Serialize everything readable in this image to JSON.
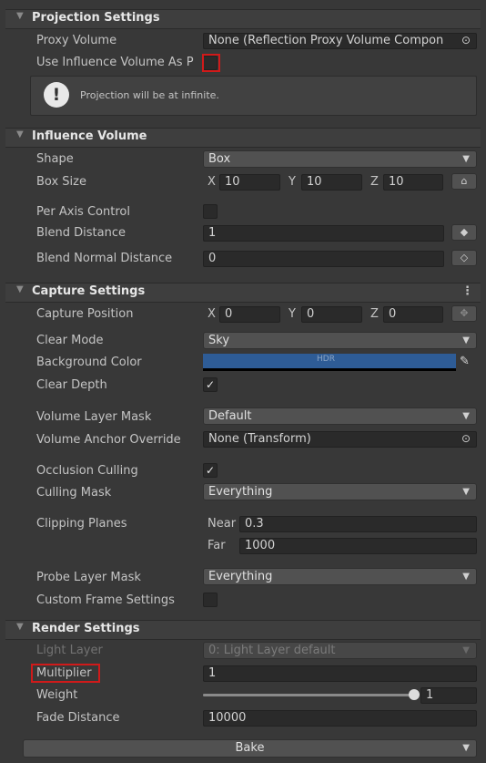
{
  "projection": {
    "title": "Projection Settings",
    "proxy_volume_label": "Proxy Volume",
    "proxy_volume_value": "None (Reflection Proxy Volume Compon",
    "use_influence_label": "Use Influence Volume As P",
    "help_text": "Projection will be at infinite."
  },
  "influence": {
    "title": "Influence Volume",
    "shape_label": "Shape",
    "shape_value": "Box",
    "box_size_label": "Box Size",
    "box_x": "10",
    "box_y": "10",
    "box_z": "10",
    "per_axis_label": "Per Axis Control",
    "blend_distance_label": "Blend Distance",
    "blend_distance_value": "1",
    "blend_normal_label": "Blend Normal Distance",
    "blend_normal_value": "0"
  },
  "capture": {
    "title": "Capture Settings",
    "position_label": "Capture Position",
    "pos_x": "0",
    "pos_y": "0",
    "pos_z": "0",
    "clear_mode_label": "Clear Mode",
    "clear_mode_value": "Sky",
    "bg_color_label": "Background Color",
    "bg_color_badge": "HDR",
    "bg_color_hex": "#2e5c96",
    "clear_depth_label": "Clear Depth",
    "volume_layer_label": "Volume Layer Mask",
    "volume_layer_value": "Default",
    "anchor_label": "Volume Anchor Override",
    "anchor_value": "None (Transform)",
    "occlusion_label": "Occlusion Culling",
    "culling_mask_label": "Culling Mask",
    "culling_mask_value": "Everything",
    "clipping_label": "Clipping Planes",
    "near_label": "Near",
    "near_value": "0.3",
    "far_label": "Far",
    "far_value": "1000",
    "probe_layer_label": "Probe Layer Mask",
    "probe_layer_value": "Everything",
    "custom_frame_label": "Custom Frame Settings"
  },
  "render": {
    "title": "Render Settings",
    "light_layer_label": "Light Layer",
    "light_layer_value": "0: Light Layer default",
    "multiplier_label": "Multiplier",
    "multiplier_value": "1",
    "weight_label": "Weight",
    "weight_value": "1",
    "weight_fraction": 1.0,
    "fade_label": "Fade Distance",
    "fade_value": "10000",
    "bake_label": "Bake"
  },
  "axes": {
    "x": "X",
    "y": "Y",
    "z": "Z"
  },
  "colors": {
    "highlight": "#d01a1a"
  }
}
